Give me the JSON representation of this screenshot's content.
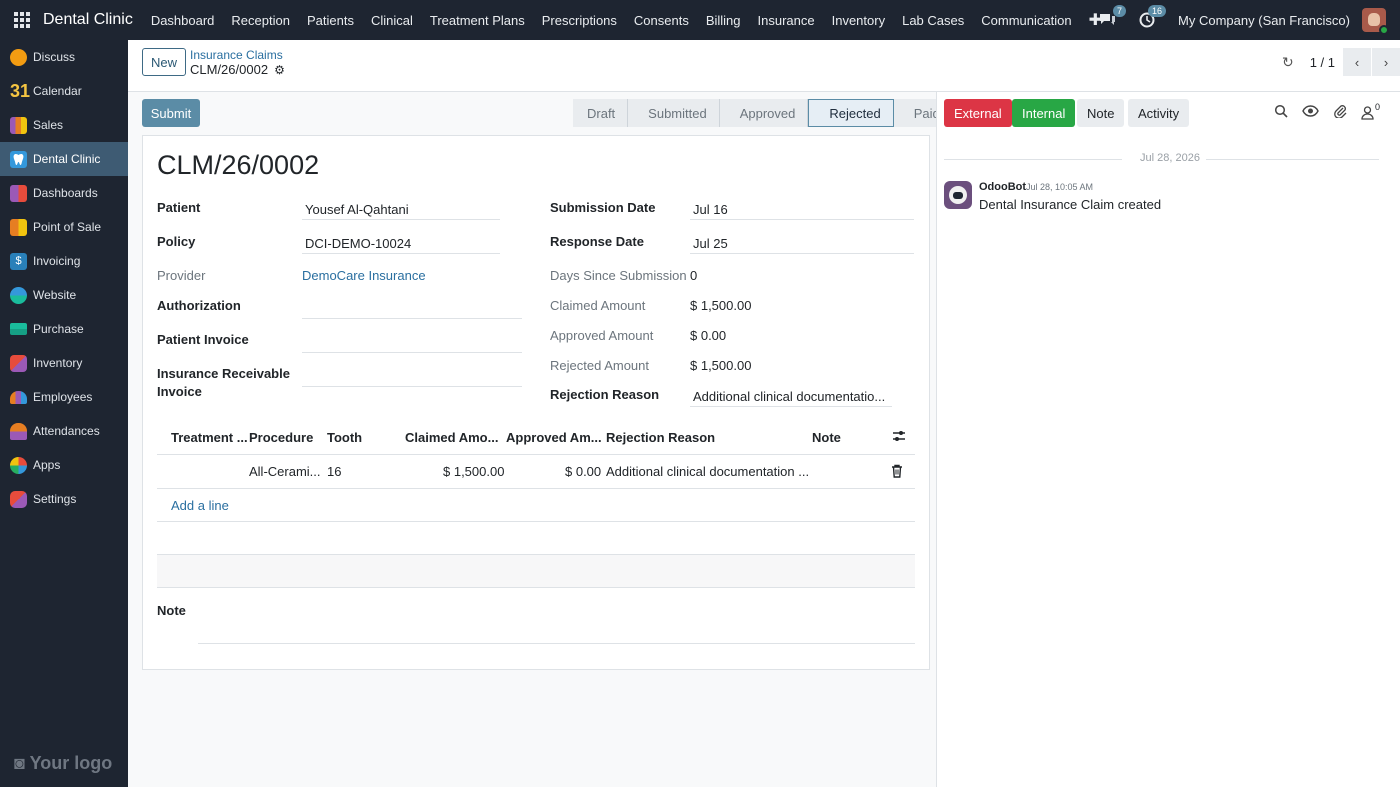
{
  "topbar": {
    "brand": "Dental Clinic",
    "menu": [
      "Dashboard",
      "Reception",
      "Patients",
      "Clinical",
      "Treatment Plans",
      "Prescriptions",
      "Consents",
      "Billing",
      "Insurance",
      "Inventory",
      "Lab Cases",
      "Communication"
    ],
    "messages_count": "7",
    "activities_count": "16",
    "company": "My Company (San Francisco)"
  },
  "sidebar": {
    "items": [
      {
        "label": "Discuss",
        "color": "#f39c12"
      },
      {
        "label": "Calendar",
        "color": "#1e2531"
      },
      {
        "label": "Sales",
        "color": "#e67e22"
      },
      {
        "label": "Dental Clinic",
        "color": "#3498db"
      },
      {
        "label": "Dashboards",
        "color": "#9b59b6"
      },
      {
        "label": "Point of Sale",
        "color": "#f1c40f"
      },
      {
        "label": "Invoicing",
        "color": "#2980b9"
      },
      {
        "label": "Website",
        "color": "#16a085"
      },
      {
        "label": "Purchase",
        "color": "#1abc9c"
      },
      {
        "label": "Inventory",
        "color": "#e74c3c"
      },
      {
        "label": "Employees",
        "color": "#8e44ad"
      },
      {
        "label": "Attendances",
        "color": "#e67e22"
      },
      {
        "label": "Apps",
        "color": "#27ae60"
      },
      {
        "label": "Settings",
        "color": "#e74c3c"
      }
    ],
    "calendar_number": "31",
    "logo_text": "Your logo"
  },
  "control": {
    "new_label": "New",
    "breadcrumb_parent": "Insurance Claims",
    "breadcrumb_current": "CLM/26/0002",
    "pager": "1 / 1"
  },
  "form": {
    "submit_label": "Submit",
    "stages": [
      "Draft",
      "Submitted",
      "Approved",
      "Rejected",
      "Paid"
    ],
    "active_stage": "Rejected",
    "title": "CLM/26/0002",
    "labels": {
      "patient": "Patient",
      "policy": "Policy",
      "provider": "Provider",
      "authorization": "Authorization",
      "patient_invoice": "Patient Invoice",
      "ins_invoice_1": "Insurance Receivable",
      "ins_invoice_2": "Invoice",
      "submission_date": "Submission Date",
      "response_date": "Response Date",
      "days_since": "Days Since Submission",
      "claimed": "Claimed Amount",
      "approved": "Approved Amount",
      "rejected": "Rejected Amount",
      "rejection_reason": "Rejection Reason",
      "note": "Note"
    },
    "values": {
      "patient": "Yousef Al-Qahtani",
      "policy": "DCI-DEMO-10024",
      "provider": "DemoCare Insurance",
      "submission_date": "Jul 16",
      "response_date": "Jul 25",
      "days_since": "0",
      "claimed": "$ 1,500.00",
      "approved": "$ 0.00",
      "rejected": "$ 1,500.00",
      "rejection_reason": "Additional clinical documentatio..."
    },
    "table": {
      "headers": [
        "Treatment ...",
        "Procedure",
        "Tooth",
        "Claimed Amo...",
        "Approved Am...",
        "Rejection Reason",
        "Note"
      ],
      "rows": [
        {
          "treatment": "",
          "procedure": "All-Cerami...",
          "tooth": "16",
          "claimed": "$ 1,500.00",
          "approved": "$ 0.00",
          "reason": "Additional clinical documentation ...",
          "note": ""
        }
      ],
      "add_line": "Add a line"
    }
  },
  "chatter": {
    "buttons": {
      "external": "External",
      "internal": "Internal",
      "note": "Note",
      "activity": "Activity"
    },
    "followers_count": "0",
    "date_separator": "Jul 28, 2026",
    "message": {
      "author": "OdooBot",
      "time": "Jul 28, 10:05 AM",
      "body": "Dental Insurance Claim created"
    }
  }
}
